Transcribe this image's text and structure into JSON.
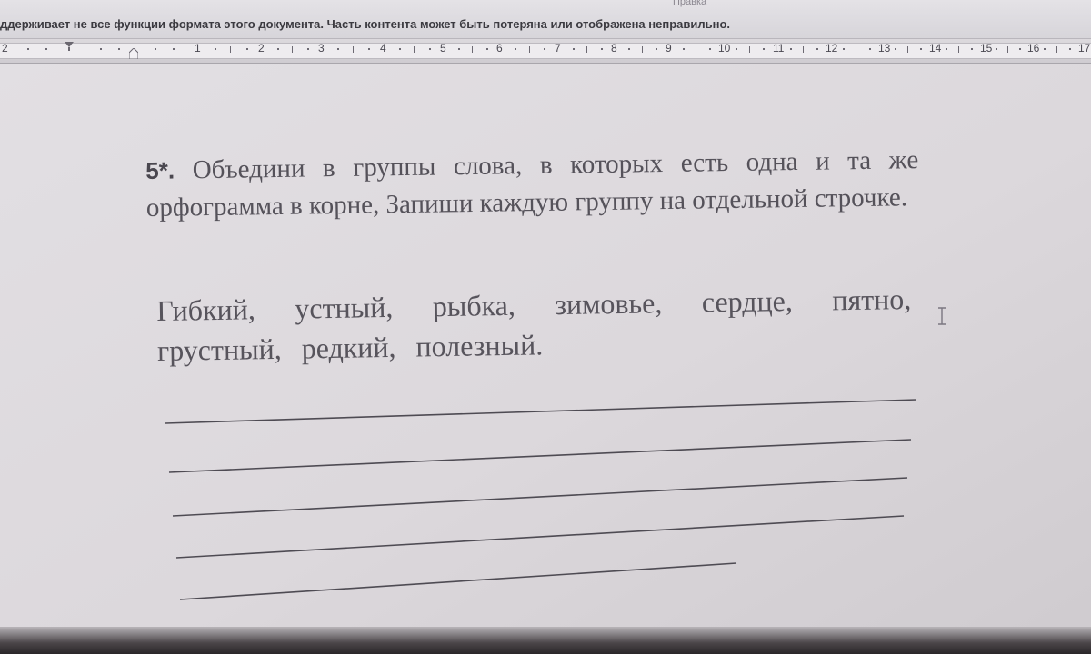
{
  "infobar": {
    "top_label": "Правка",
    "message": "ддерживает не все функции формата этого документа. Часть контента может быть потеряна или отображена неправильно."
  },
  "ruler": {
    "numbers": [
      "2",
      "1",
      "2",
      "3",
      "4",
      "5",
      "6",
      "7",
      "8",
      "9",
      "10",
      "11",
      "12",
      "13",
      "14",
      "15",
      "16",
      "17"
    ]
  },
  "document": {
    "task_number": "5*.",
    "task_text": "Объедини  в группы слова, в которых есть одна и та же орфограмма в корне, Запиши каждую группу на отдельной строчке.",
    "words": "Гибкий, устный, рыбка, зимовье, сердце, пятно, грустный, редкий, полезный."
  },
  "colors": {
    "text": "#55525a",
    "page_bg": "#dedbde",
    "ruler_bg": "#eeecef"
  },
  "icons": {
    "tab_marker": "tab-stop-icon",
    "indent_marker": "indent-marker-icon",
    "cursor": "text-cursor-icon"
  }
}
